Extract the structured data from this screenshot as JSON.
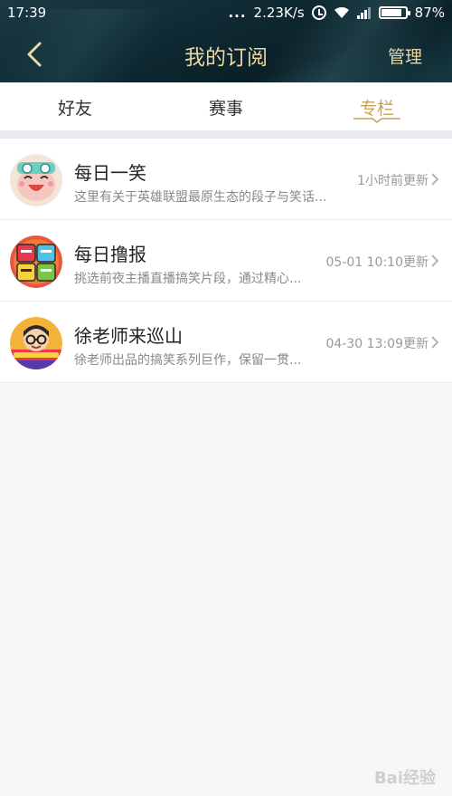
{
  "status_bar": {
    "time": "17:39",
    "dots": "...",
    "network_speed": "2.23K/s",
    "battery": "87%",
    "icons": [
      "alarm-icon",
      "wifi-icon",
      "signal-icon",
      "battery-icon"
    ]
  },
  "header": {
    "back_icon": "chevron-left-icon",
    "title": "我的订阅",
    "manage_label": "管理"
  },
  "tabs": [
    {
      "label": "好友",
      "active": false
    },
    {
      "label": "赛事",
      "active": false
    },
    {
      "label": "专栏",
      "active": true
    }
  ],
  "subscriptions": [
    {
      "title": "每日一笑",
      "description": "这里有关于英雄联盟最原生态的段子与笑话...",
      "updated": "1小时前更新",
      "avatar": "smiling-cartoon-avatar"
    },
    {
      "title": "每日撸报",
      "description": "挑选前夜主播直播搞笑片段，通过精心...",
      "updated": "05-01 10:10更新",
      "avatar": "daily-report-logo-avatar"
    },
    {
      "title": "徐老师来巡山",
      "description": "徐老师出品的搞笑系列巨作，保留一贯...",
      "updated": "04-30 13:09更新",
      "avatar": "teacher-xu-avatar"
    }
  ],
  "colors": {
    "accent_gold": "#c5a25a",
    "header_text": "#e9d7a6",
    "header_bg": "#0f2a33"
  },
  "watermark": "Bai经验"
}
